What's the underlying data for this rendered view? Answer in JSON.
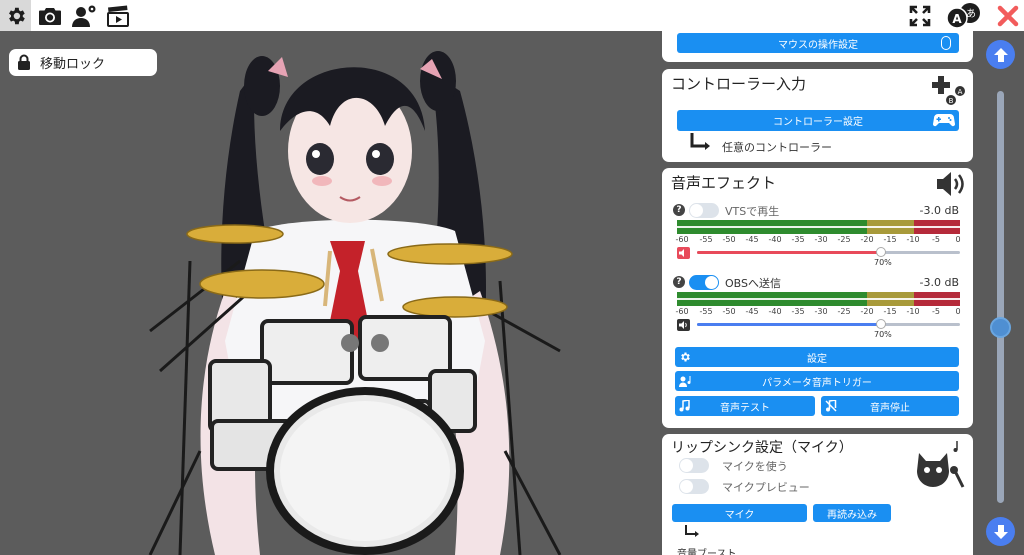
{
  "toolbar": {
    "icons": [
      "gear-icon",
      "camera-icon",
      "user-settings-icon",
      "clapperboard-icon",
      "fullscreen-icon",
      "language-icon",
      "close-icon"
    ]
  },
  "viewport": {
    "lock_label": "移動ロック"
  },
  "mouse_card": {
    "button_label": "マウスの操作設定"
  },
  "controller_card": {
    "title": "コントローラー入力",
    "button_label": "コントローラー設定",
    "sub_label": "任意のコントローラー"
  },
  "audio_card": {
    "title": "音声エフェクト",
    "vts": {
      "label": "VTSで再生",
      "enabled": false,
      "db": "-3.0 dB",
      "volume_percent": "70%",
      "volume_fraction": 0.7
    },
    "obs": {
      "label": "OBSへ送信",
      "enabled": true,
      "db": "-3.0 dB",
      "volume_percent": "70%",
      "volume_fraction": 0.7
    },
    "scale_ticks": [
      "-60",
      "-55",
      "-50",
      "-45",
      "-40",
      "-35",
      "-30",
      "-25",
      "-20",
      "-15",
      "-10",
      "-5",
      "0"
    ],
    "settings_label": "設定",
    "param_trigger_label": "パラメータ音声トリガー",
    "test_label": "音声テスト",
    "stop_label": "音声停止"
  },
  "lipsync_card": {
    "title": "リップシンク設定（マイク）",
    "use_mic_label": "マイクを使う",
    "mic_preview_label": "マイクプレビュー",
    "mic_button_label": "マイク",
    "reload_label": "再読み込み",
    "volume_boost_label": "音量ブースト"
  },
  "colors": {
    "accent": "#1a8ff2",
    "meter_green": "#2e8b2e",
    "meter_yellow": "#a89a3a",
    "meter_red": "#b52a3a"
  }
}
